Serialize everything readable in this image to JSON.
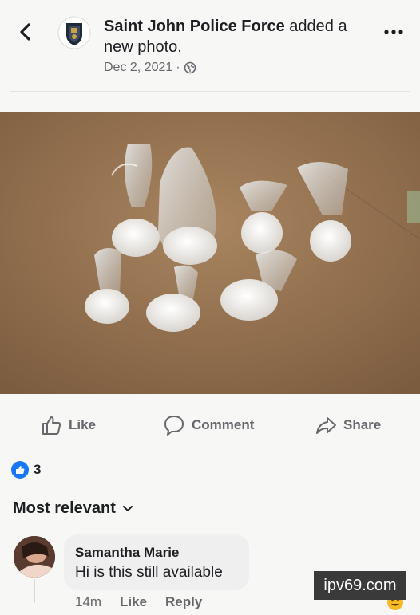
{
  "header": {
    "page_name": "Saint John Police Force",
    "action_text": " added a new photo.",
    "date": "Dec 2, 2021",
    "separator": "·",
    "back_icon": "chevron-left-icon",
    "privacy_icon": "globe-icon",
    "more_icon": "more-horizontal-icon"
  },
  "actions": {
    "like_label": "Like",
    "comment_label": "Comment",
    "share_label": "Share"
  },
  "reactions": {
    "count": "3",
    "type": "like"
  },
  "comments": {
    "sort_label": "Most relevant",
    "items": [
      {
        "author": "Samantha Marie",
        "text": "Hi is this still available",
        "time": "14m",
        "like_label": "Like",
        "reply_label": "Reply"
      }
    ]
  },
  "watermark": {
    "text": "ipv69.com"
  },
  "colors": {
    "brand_blue": "#1877f2",
    "meta_gray": "#65676b",
    "text": "#1c1e21"
  }
}
